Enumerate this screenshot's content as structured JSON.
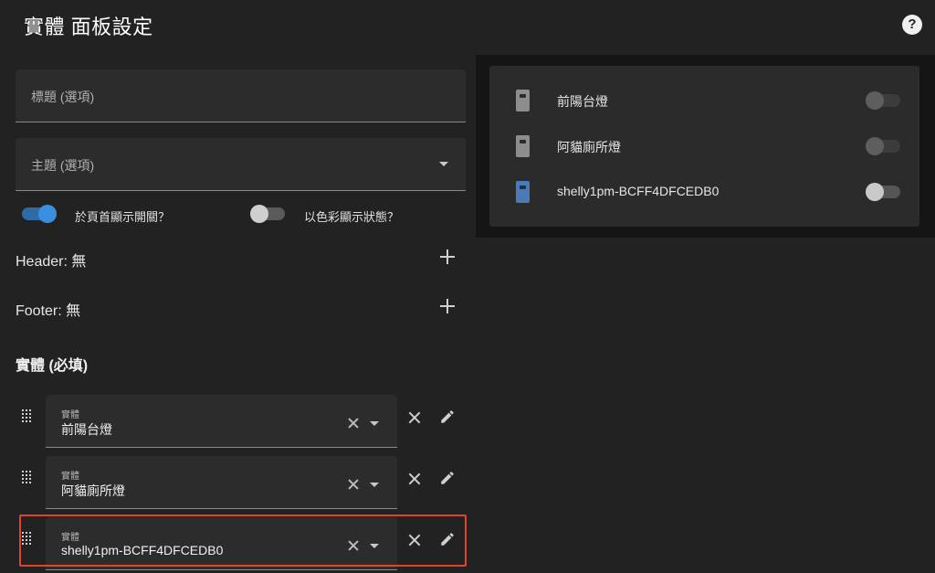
{
  "page": {
    "title": "實體 面板設定"
  },
  "fields": {
    "title_placeholder": "標題 (選項)",
    "theme_placeholder": "主題 (選項)"
  },
  "toggles": {
    "show_header_toggle": {
      "label": "於頁首顯示開關？",
      "on": true
    },
    "state_color": {
      "label": "以色彩顯示狀態？",
      "on": false
    }
  },
  "header_row": {
    "label": "Header: 無"
  },
  "footer_row": {
    "label": "Footer: 無"
  },
  "entities_section": {
    "title": "實體 (必填)",
    "items": [
      {
        "label": "實體",
        "value": "前陽台燈"
      },
      {
        "label": "實體",
        "value": "阿貓廁所燈"
      },
      {
        "label": "實體",
        "value": "shelly1pm-BCFF4DFCEDB0"
      }
    ]
  },
  "preview": {
    "entities": [
      {
        "name": "前陽台燈",
        "icon": "device-gray-icon"
      },
      {
        "name": "阿貓廁所燈",
        "icon": "device-gray-icon"
      },
      {
        "name": "shelly1pm-BCFF4DFCEDB0",
        "icon": "device-blue-icon"
      }
    ]
  },
  "colors": {
    "accent": "#3a8fdf",
    "highlight": "#e0452a",
    "background": "#222222"
  }
}
